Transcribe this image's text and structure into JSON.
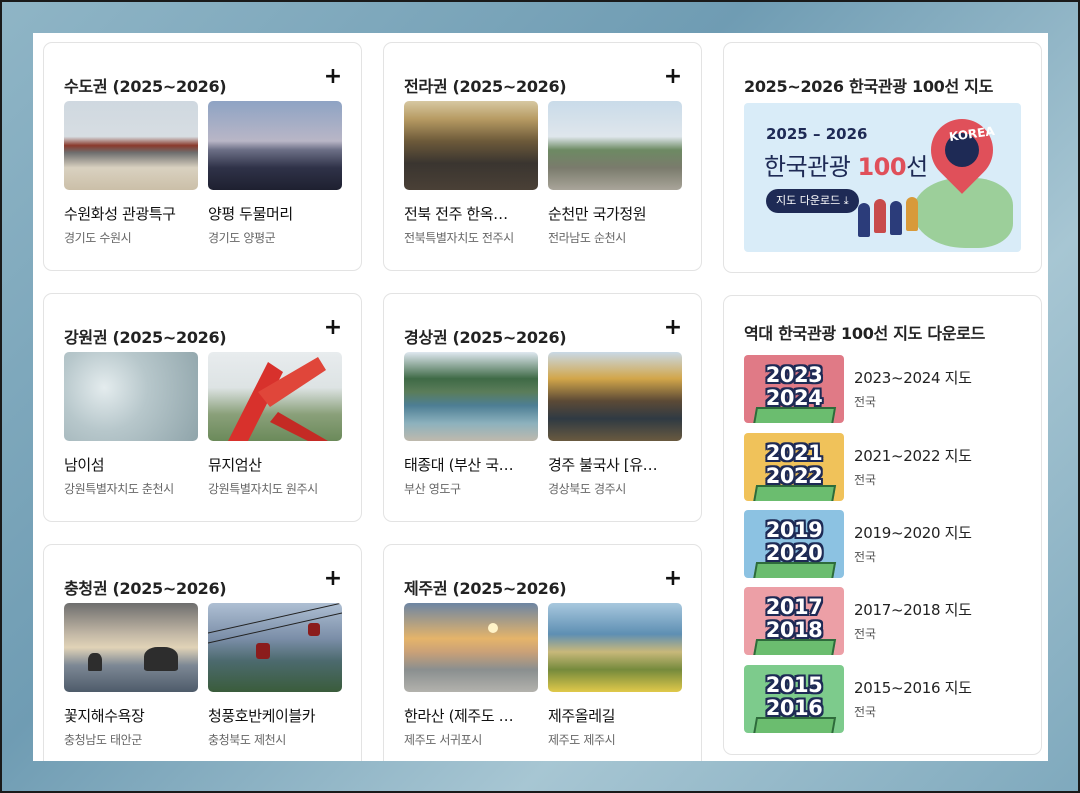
{
  "regions": [
    {
      "title": "수도권 (2025~2026)",
      "items": [
        {
          "name": "수원화성 관광특구",
          "location": "경기도 수원시"
        },
        {
          "name": "양평 두물머리",
          "location": "경기도 양평군"
        }
      ]
    },
    {
      "title": "전라권 (2025~2026)",
      "items": [
        {
          "name": "전북 전주 한옥…",
          "location": "전북특별자치도 전주시"
        },
        {
          "name": "순천만 국가정원",
          "location": "전라남도 순천시"
        }
      ]
    },
    {
      "title": "강원권 (2025~2026)",
      "items": [
        {
          "name": "남이섬",
          "location": "강원특별자치도 춘천시"
        },
        {
          "name": "뮤지엄산",
          "location": "강원특별자치도 원주시"
        }
      ]
    },
    {
      "title": "경상권 (2025~2026)",
      "items": [
        {
          "name": "태종대 (부산 국…",
          "location": "부산 영도구"
        },
        {
          "name": "경주 불국사 [유…",
          "location": "경상북도 경주시"
        }
      ]
    },
    {
      "title": "충청권 (2025~2026)",
      "items": [
        {
          "name": "꽃지해수욕장",
          "location": "충청남도 태안군"
        },
        {
          "name": "청풍호반케이블카",
          "location": "충청북도 제천시"
        }
      ]
    },
    {
      "title": "제주권 (2025~2026)",
      "items": [
        {
          "name": "한라산 (제주도 …",
          "location": "제주도 서귀포시"
        },
        {
          "name": "제주올레길",
          "location": "제주도 제주시"
        }
      ]
    }
  ],
  "plus_glyph": "+",
  "map_card": {
    "title": "2025~2026 한국관광 100선 지도",
    "banner_years": "2025 – 2026",
    "banner_main_prefix": "한국관광 ",
    "banner_main_number": "100",
    "banner_main_suffix": "선",
    "download_button": "지도 다운로드 ⤓",
    "logo_text": "KOREA"
  },
  "history_card": {
    "title": "역대 한국관광 100선 지도 다운로드",
    "items": [
      {
        "year_top": "2023",
        "year_bottom": "2024",
        "label": "2023~2024 지도",
        "sub": "전국",
        "color": "#e07a86"
      },
      {
        "year_top": "2021",
        "year_bottom": "2022",
        "label": "2021~2022 지도",
        "sub": "전국",
        "color": "#f0c25a"
      },
      {
        "year_top": "2019",
        "year_bottom": "2020",
        "label": "2019~2020 지도",
        "sub": "전국",
        "color": "#8cc2e2"
      },
      {
        "year_top": "2017",
        "year_bottom": "2018",
        "label": "2017~2018 지도",
        "sub": "전국",
        "color": "#ec9fa6"
      },
      {
        "year_top": "2015",
        "year_bottom": "2016",
        "label": "2015~2016 지도",
        "sub": "전국",
        "color": "#7dcb8c"
      }
    ]
  }
}
